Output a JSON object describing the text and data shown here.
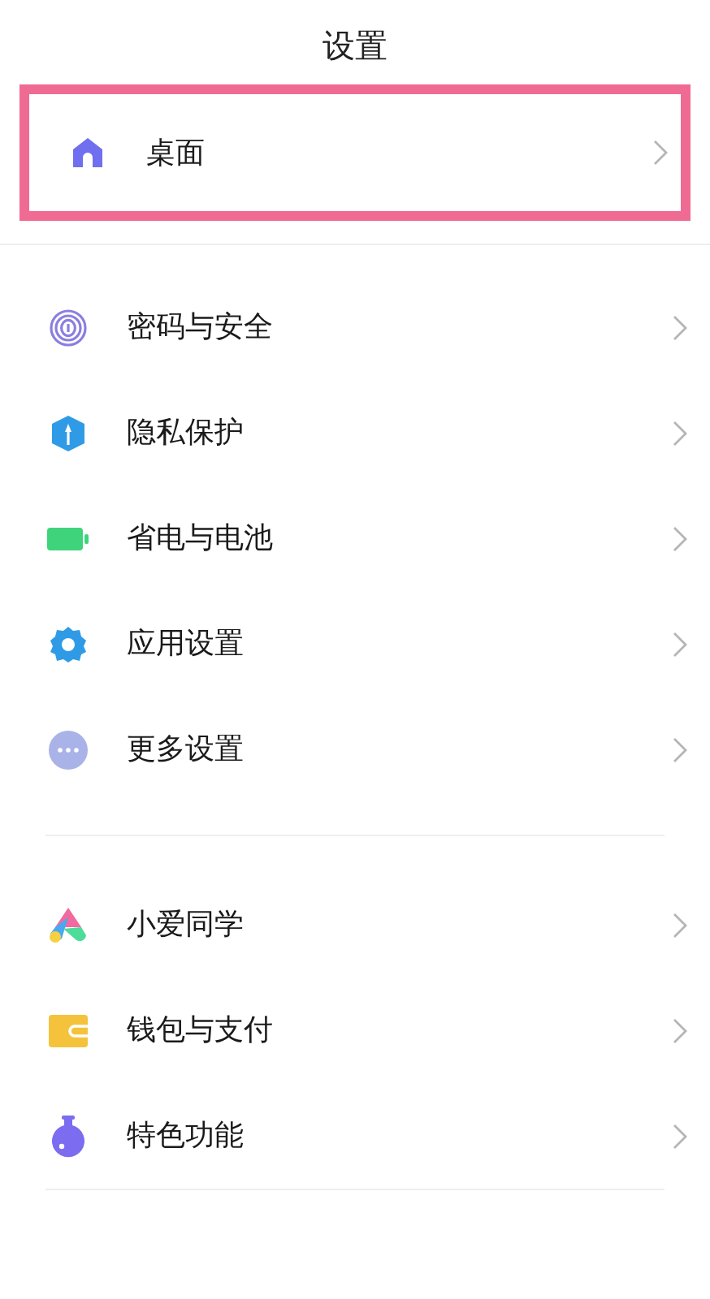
{
  "title": "设置",
  "sections": [
    {
      "items": [
        {
          "label": "桌面",
          "highlighted": true
        }
      ]
    },
    {
      "items": [
        {
          "label": "密码与安全",
          "highlighted": false
        },
        {
          "label": "隐私保护",
          "highlighted": false
        },
        {
          "label": "省电与电池",
          "highlighted": false
        },
        {
          "label": "应用设置",
          "highlighted": false
        },
        {
          "label": "更多设置",
          "highlighted": false
        }
      ]
    },
    {
      "items": [
        {
          "label": "小爱同学",
          "highlighted": false
        },
        {
          "label": "钱包与支付",
          "highlighted": false
        },
        {
          "label": "特色功能",
          "highlighted": false
        }
      ]
    }
  ]
}
